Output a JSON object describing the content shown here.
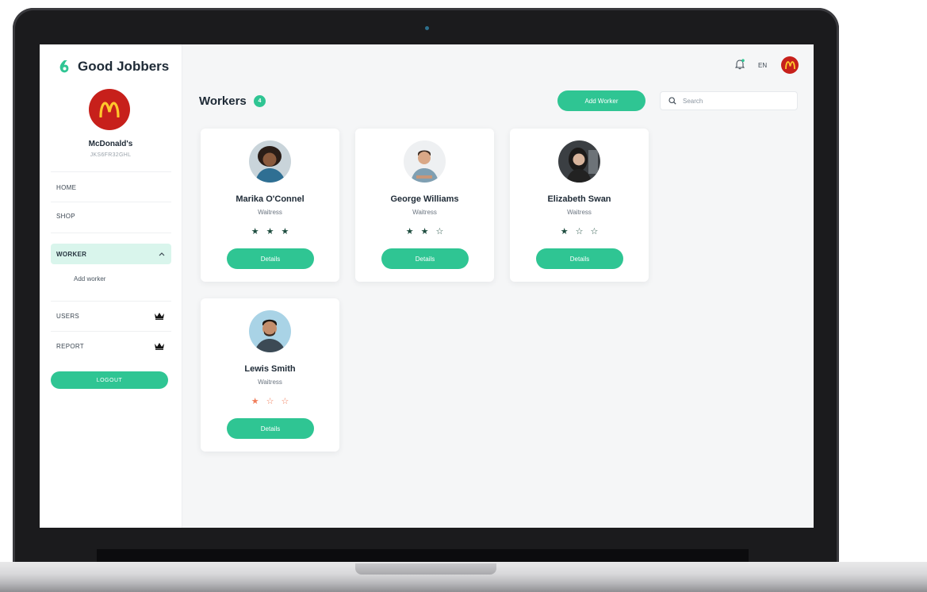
{
  "brand": {
    "name": "Good Jobbers"
  },
  "company": {
    "name": "McDonald's",
    "code": "JKS6FR32GHL"
  },
  "nav": {
    "home": "HOME",
    "shop": "SHOP",
    "worker": "WORKER",
    "worker_sub": "Add worker",
    "users": "USERS",
    "report": "REPORT",
    "logout": "LOGOUT"
  },
  "topbar": {
    "lang": "EN"
  },
  "header": {
    "title": "Workers",
    "count": "4",
    "add_worker": "Add Worker",
    "search_placeholder": "Search"
  },
  "workers": [
    {
      "name": "Marika O'Connel",
      "role": "Waitress",
      "rating": 3,
      "max_rating": 5,
      "details": "Details"
    },
    {
      "name": "George Williams",
      "role": "Waitress",
      "rating": 2,
      "max_rating": 5,
      "details": "Details"
    },
    {
      "name": "Elizabeth Swan",
      "role": "Waitress",
      "rating": 1,
      "max_rating": 5,
      "details": "Details"
    },
    {
      "name": "Lewis Smith",
      "role": "Waitress",
      "rating": 1,
      "max_rating": 5,
      "details": "Details"
    }
  ],
  "colors": {
    "accent": "#2fc593",
    "brand_red": "#c7201b",
    "star_dark": "#1e4d3f",
    "star_orange": "#f07d5a"
  }
}
